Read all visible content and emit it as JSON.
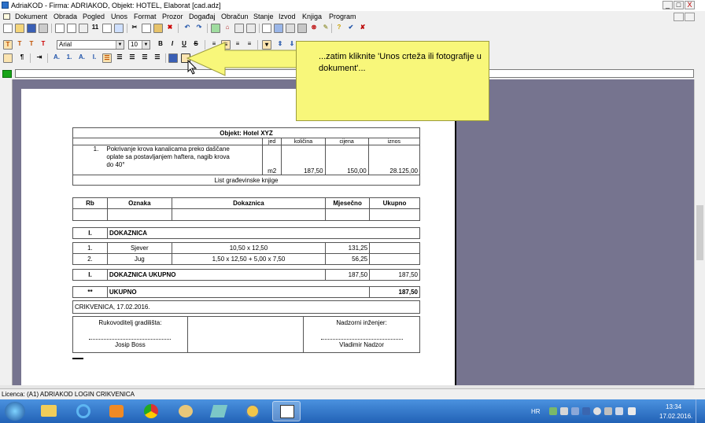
{
  "window": {
    "title": "AdriaKOD - Firma: ADRIAKOD,  Objekt: HOTEL, Elaborat [cad.adz]",
    "min_label": "_",
    "max_label": "□",
    "close_label": "X"
  },
  "menu": [
    "Dokument",
    "Obrada",
    "Pogled",
    "Unos",
    "Format",
    "Prozor",
    "Događaj",
    "Obračun",
    "Stanje",
    "Izvod",
    "Knjiga",
    "Program"
  ],
  "toolbar": {
    "font_name": "Arial",
    "font_size": "10",
    "bold": "B",
    "italic": "I",
    "underline": "U",
    "strike": "S",
    "text_labels": [
      "T",
      "T",
      "T",
      "T"
    ],
    "list_labels": [
      "A.",
      "1.",
      "A.",
      "I."
    ],
    "undo_count": "11"
  },
  "callout": {
    "text": "...zatim kliknite 'Unos crteža ili fotografije u dokument'..."
  },
  "document": {
    "header_title": "Objekt: Hotel XYZ",
    "col_headers": [
      "jed",
      "količina",
      "cijena",
      "iznos"
    ],
    "item": {
      "rb": "1.",
      "desc": [
        "Pokrivanje krova kanalicama preko daščane",
        "oplate sa postavljanjem haftera, nagib krova",
        "do 40°"
      ],
      "unit": "m2",
      "qty": "187,50",
      "price": "150,00",
      "amount": "28.125,00"
    },
    "list_title": "List građevinske knjige",
    "table_headers": [
      "Rb",
      "Oznaka",
      "Dokaznica",
      "Mjesečno",
      "Ukupno"
    ],
    "section": {
      "rb": "I.",
      "label": "DOKAZNICA"
    },
    "rows": [
      {
        "rb": "1.",
        "oznaka": "Sjever",
        "dokaznica": "10,50 x 12,50",
        "mjesecno": "131,25",
        "ukupno": ""
      },
      {
        "rb": "2.",
        "oznaka": "Jug",
        "dokaznica": "1,50 x 12,50 + 5,00 x 7,50",
        "mjesecno": "56,25",
        "ukupno": ""
      }
    ],
    "subtotal": {
      "rb": "I.",
      "label": "DOKAZNICA UKUPNO",
      "mjesecno": "187,50",
      "ukupno": "187,50"
    },
    "total": {
      "rb": "**",
      "label": "UKUPNO",
      "ukupno": "187,50"
    },
    "place_date": "CRIKVENICA, 17.02.2016.",
    "signatures": {
      "left_title": "Rukovoditelj gradilišta:",
      "left_name": "Josip Boss",
      "right_title": "Nadzorni inženjer:",
      "right_name": "Vladimir Nadzor"
    }
  },
  "status": {
    "license": "Licenca: (A1) ADRIAKOD LOGIN CRIKVENICA"
  },
  "taskbar": {
    "lang": "HR",
    "time": "13:34",
    "date": "17.02.2016."
  },
  "colors": {
    "workspace": "#76748f",
    "callout": "#f8f77a",
    "taskbar": "#2b7ad1"
  }
}
